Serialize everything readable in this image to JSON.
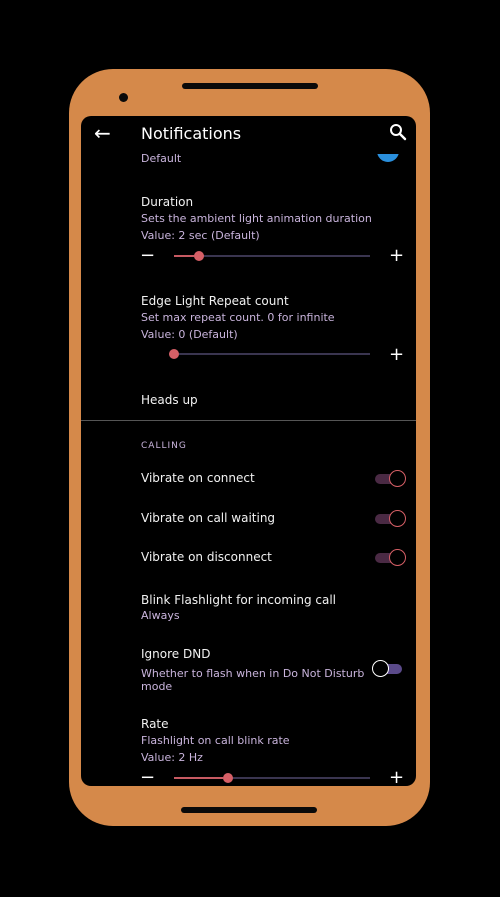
{
  "toolbar": {
    "title": "Notifications",
    "back_icon": "←",
    "search_icon": "⚲"
  },
  "prefs": {
    "top_summary": "Default",
    "duration": {
      "title": "Duration",
      "summary": "Sets the ambient light animation duration",
      "value": "Value: 2 sec (Default)",
      "level": 0.1
    },
    "repeat": {
      "title": "Edge Light Repeat count",
      "summary": "Set max repeat count. 0 for infinite",
      "value": "Value: 0 (Default)",
      "level": 0.0
    },
    "heads_up": {
      "title": "Heads up"
    },
    "calling_header": "CALLING",
    "vibrate_connect": {
      "title": "Vibrate on connect",
      "on": true
    },
    "vibrate_waiting": {
      "title": "Vibrate on call waiting",
      "on": true
    },
    "vibrate_disconnect": {
      "title": "Vibrate on disconnect",
      "on": true
    },
    "blink": {
      "title": "Blink Flashlight for incoming call",
      "summary": "Always"
    },
    "ignore_dnd": {
      "title": "Ignore DND",
      "summary_line1": "Whether to flash when in Do Not Disturb",
      "summary_line2": "mode",
      "on": false
    },
    "rate": {
      "title": "Rate",
      "summary": "Flashlight on call blink rate",
      "value": "Value: 2 Hz",
      "level": 0.25
    }
  },
  "controls": {
    "minus": "−",
    "plus": "+"
  },
  "colors": {
    "accent": "#d65f66",
    "summary_text": "#c9b4dc",
    "frame": "#d5894a",
    "switch_off_track": "#5b4a8a"
  }
}
